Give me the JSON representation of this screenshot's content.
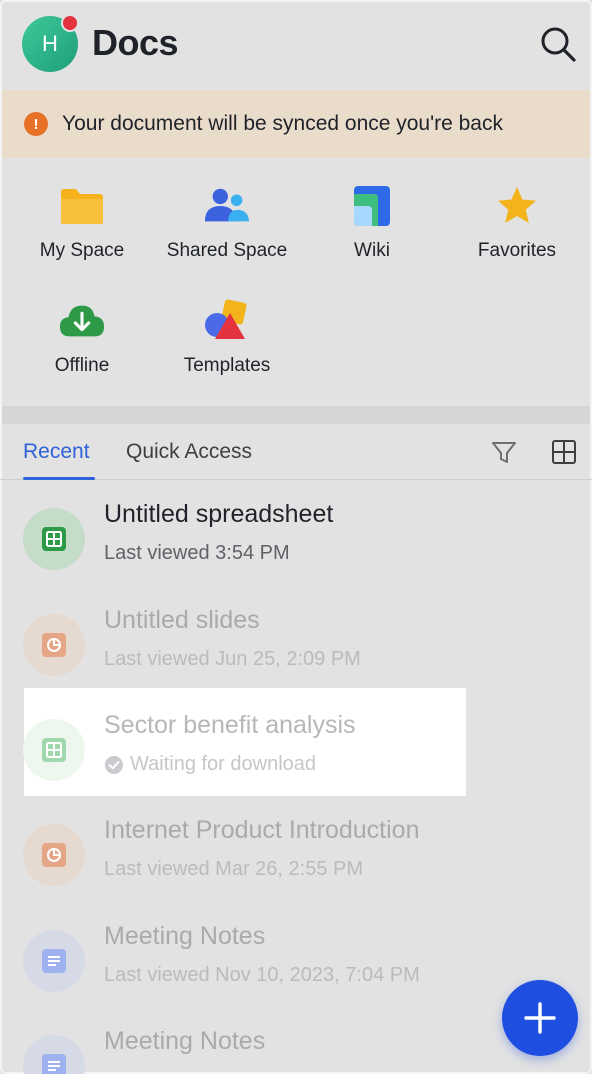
{
  "header": {
    "avatar_initial": "H",
    "title": "Docs"
  },
  "banner": {
    "text": "Your document will be synced once you're back",
    "icon": "!"
  },
  "quick_grid": [
    {
      "label": "My Space",
      "icon": "folder-icon"
    },
    {
      "label": "Shared Space",
      "icon": "people-icon"
    },
    {
      "label": "Wiki",
      "icon": "wiki-icon"
    },
    {
      "label": "Favorites",
      "icon": "star-icon"
    },
    {
      "label": "Offline",
      "icon": "cloud-download-icon"
    },
    {
      "label": "Templates",
      "icon": "shapes-icon"
    }
  ],
  "tabs": {
    "recent": "Recent",
    "quick_access": "Quick Access"
  },
  "files": [
    {
      "title": "Untitled spreadsheet",
      "subtitle": "Last viewed 3:54 PM",
      "type": "sheet"
    },
    {
      "title": "Untitled slides",
      "subtitle": "Last viewed Jun 25, 2:09 PM",
      "type": "slides"
    },
    {
      "title": "Sector benefit analysis",
      "subtitle": "Waiting for download",
      "type": "sheet"
    },
    {
      "title": "Internet Product Introduction",
      "subtitle": "Last viewed Mar 26, 2:55 PM",
      "type": "slides"
    },
    {
      "title": "Meeting Notes",
      "subtitle": "Last viewed Nov 10, 2023, 7:04 PM",
      "type": "doc"
    },
    {
      "title": "Meeting Notes",
      "subtitle": "",
      "type": "doc"
    }
  ],
  "colors": {
    "accent": "#2f62d8",
    "fab": "#1f4fe0",
    "banner_bg": "#e9dccb",
    "sheet_green": "#2e9a48",
    "slides_orange": "#e07a3a",
    "doc_blue": "#5b7be8"
  }
}
